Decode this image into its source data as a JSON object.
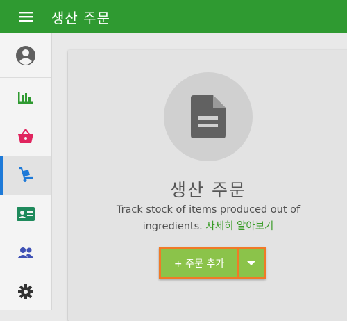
{
  "header": {
    "title": "생산 주문",
    "menu_icon": "hamburger-icon"
  },
  "sidebar": {
    "items": [
      {
        "name": "account",
        "icon": "account-circle-icon"
      },
      {
        "name": "reports",
        "icon": "bar-chart-icon",
        "color": "#2f9a31"
      },
      {
        "name": "sales",
        "icon": "basket-icon",
        "color": "#e0245e"
      },
      {
        "name": "production",
        "icon": "hand-truck-icon",
        "color": "#1e7ad8",
        "active": true
      },
      {
        "name": "contacts",
        "icon": "contact-card-icon",
        "color": "#1f8a5c"
      },
      {
        "name": "team",
        "icon": "people-icon",
        "color": "#3f51b5"
      },
      {
        "name": "settings",
        "icon": "gear-icon",
        "color": "#333333"
      }
    ],
    "accent": "#1e7ad8"
  },
  "empty_state": {
    "icon": "document-icon",
    "title": "생산 주문",
    "description": "Track stock of items produced out of ingredients.",
    "learn_more": "자세히 알아보기",
    "add_button": "+ 주문 추가",
    "dropdown_icon": "caret-down-icon"
  },
  "colors": {
    "header": "#2f9a31",
    "button": "#8bc34a",
    "highlight": "#f07a27",
    "link": "#3a9c28"
  }
}
